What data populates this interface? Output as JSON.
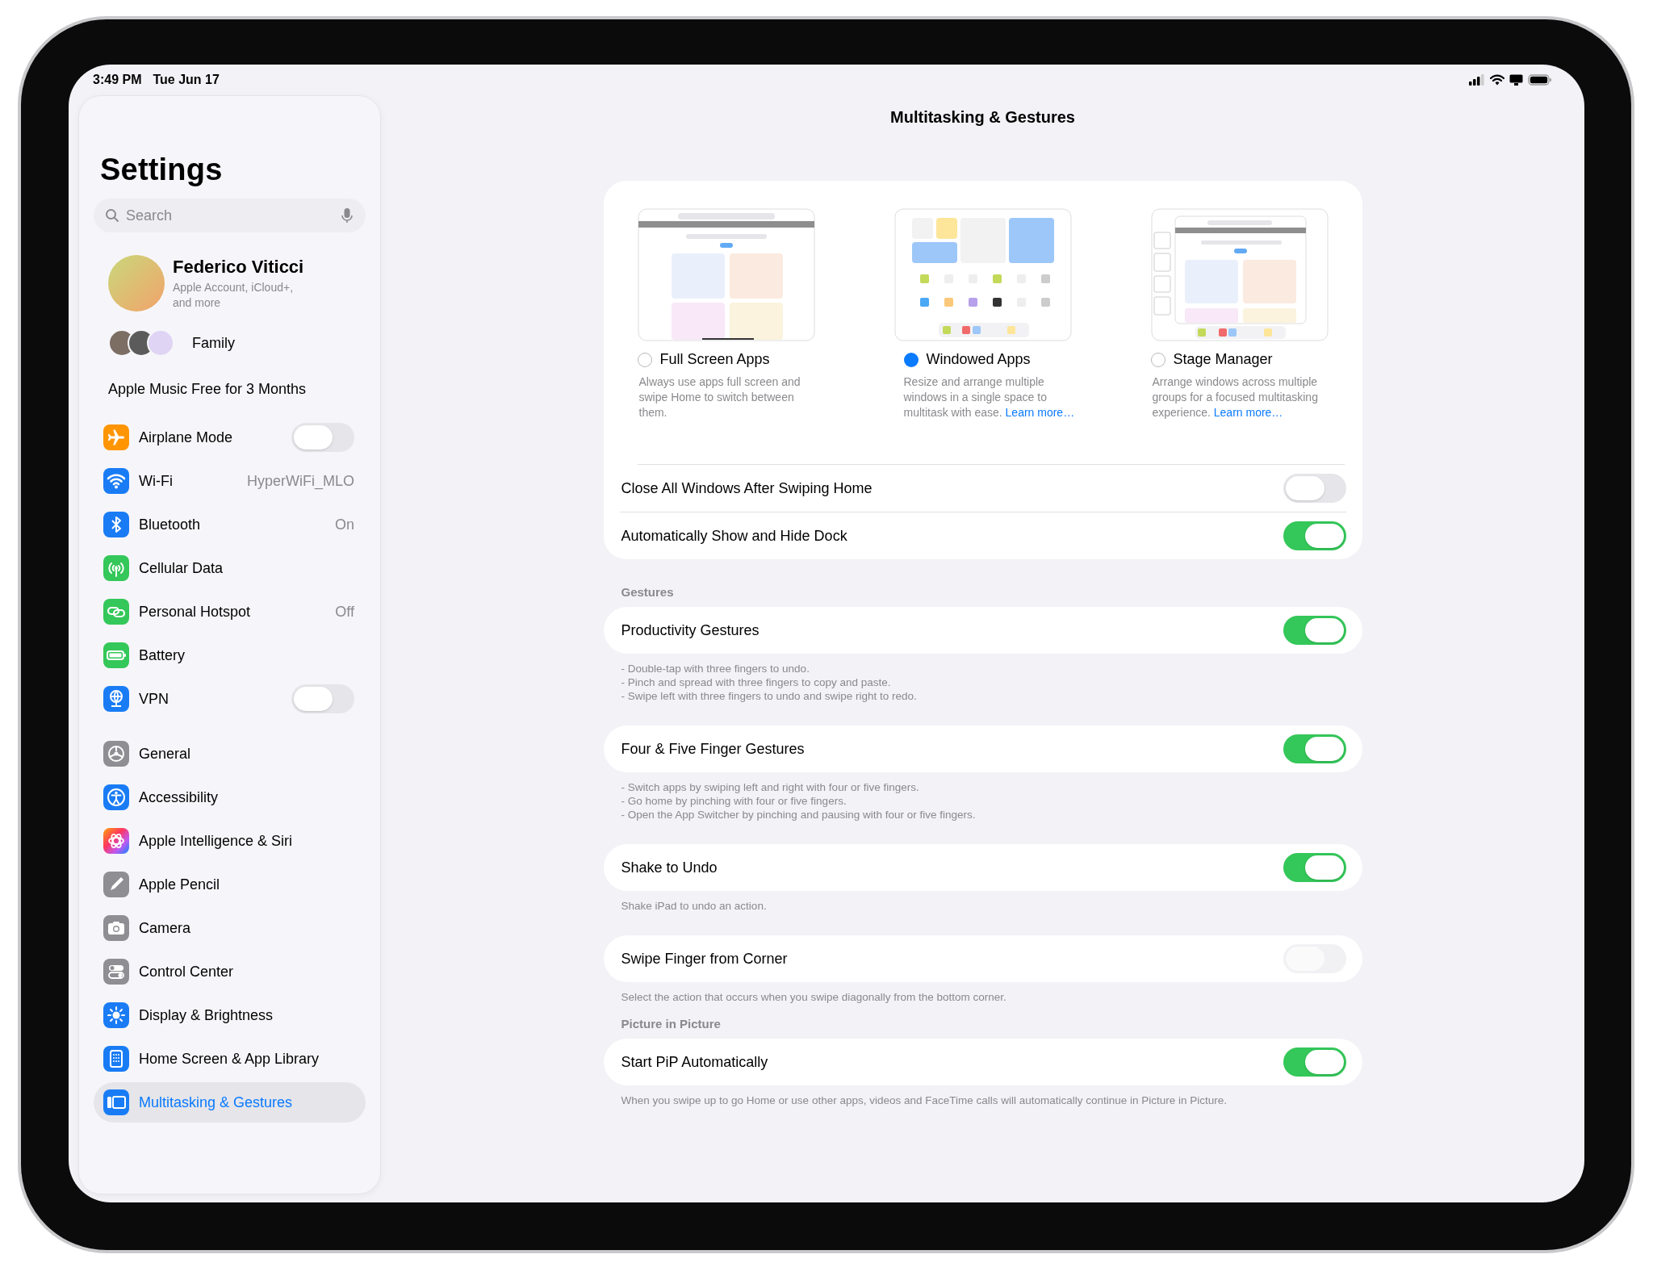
{
  "status_bar": {
    "time": "3:49 PM",
    "date": "Tue Jun 17"
  },
  "sidebar": {
    "title": "Settings",
    "search": {
      "placeholder": "Search"
    },
    "profile": {
      "name": "Federico Viticci",
      "subtitle": "Apple Account, iCloud+, and more"
    },
    "family": {
      "label": "Family"
    },
    "promo": {
      "label": "Apple Music Free for 3 Months"
    },
    "groups": [
      {
        "items": [
          {
            "label": "Airplane Mode",
            "kind": "toggle",
            "on": false,
            "selected": false
          },
          {
            "label": "Wi-Fi",
            "kind": "value",
            "value": "HyperWiFi_MLO",
            "selected": false
          },
          {
            "label": "Bluetooth",
            "kind": "value",
            "value": "On",
            "selected": false
          },
          {
            "label": "Cellular Data",
            "kind": "link",
            "selected": false
          },
          {
            "label": "Personal Hotspot",
            "kind": "value",
            "value": "Off",
            "selected": false
          },
          {
            "label": "Battery",
            "kind": "link",
            "selected": false
          },
          {
            "label": "VPN",
            "kind": "toggle",
            "on": false,
            "selected": false
          }
        ]
      },
      {
        "items": [
          {
            "label": "General",
            "kind": "link",
            "selected": false
          },
          {
            "label": "Accessibility",
            "kind": "link",
            "selected": false
          },
          {
            "label": "Apple Intelligence & Siri",
            "kind": "link",
            "selected": false
          },
          {
            "label": "Apple Pencil",
            "kind": "link",
            "selected": false
          },
          {
            "label": "Camera",
            "kind": "link",
            "selected": false
          },
          {
            "label": "Control Center",
            "kind": "link",
            "selected": false
          },
          {
            "label": "Display & Brightness",
            "kind": "link",
            "selected": false
          },
          {
            "label": "Home Screen & App Library",
            "kind": "link",
            "selected": false
          },
          {
            "label": "Multitasking & Gestures",
            "kind": "link",
            "selected": true
          }
        ]
      }
    ]
  },
  "main": {
    "title": "Multitasking & Gestures",
    "layout": {
      "options": [
        {
          "label": "Full Screen Apps",
          "description": "Always use apps full screen and swipe Home to switch between them.",
          "selected": false
        },
        {
          "label": "Windowed Apps",
          "description": "Resize and arrange multiple windows in a single space to multitask with ease.",
          "link": "Learn more…",
          "selected": true
        },
        {
          "label": "Stage Manager",
          "description": "Arrange windows across multiple groups for a focused multitasking experience.",
          "link": "Learn more…",
          "selected": false
        }
      ],
      "rows": [
        {
          "label": "Close All Windows After Swiping Home",
          "on": false
        },
        {
          "label": "Automatically Show and Hide Dock",
          "on": true
        }
      ]
    },
    "sections": [
      {
        "header": "Gestures",
        "row": {
          "label": "Productivity Gestures",
          "on": true,
          "disabled": false
        },
        "footer": [
          "- Double-tap with three fingers to undo.",
          "- Pinch and spread with three fingers to copy and paste.",
          "- Swipe left with three fingers to undo and swipe right to redo."
        ]
      },
      {
        "row": {
          "label": "Four & Five Finger Gestures",
          "on": true,
          "disabled": false
        },
        "footer": [
          "- Switch apps by swiping left and right with four or five fingers.",
          "- Go home by pinching with four or five fingers.",
          "- Open the App Switcher by pinching and pausing with four or five fingers."
        ]
      },
      {
        "row": {
          "label": "Shake to Undo",
          "on": true,
          "disabled": false
        },
        "footer": [
          "Shake iPad to undo an action."
        ]
      },
      {
        "row": {
          "label": "Swipe Finger from Corner",
          "on": false,
          "disabled": true
        },
        "footer": [
          "Select the action that occurs when you swipe diagonally from the bottom corner."
        ]
      },
      {
        "header": "Picture in Picture",
        "row": {
          "label": "Start PiP Automatically",
          "on": true,
          "disabled": false
        },
        "footer": [
          "When you swipe up to go Home or use other apps, videos and FaceTime calls will automatically continue in Picture in Picture."
        ]
      }
    ]
  }
}
